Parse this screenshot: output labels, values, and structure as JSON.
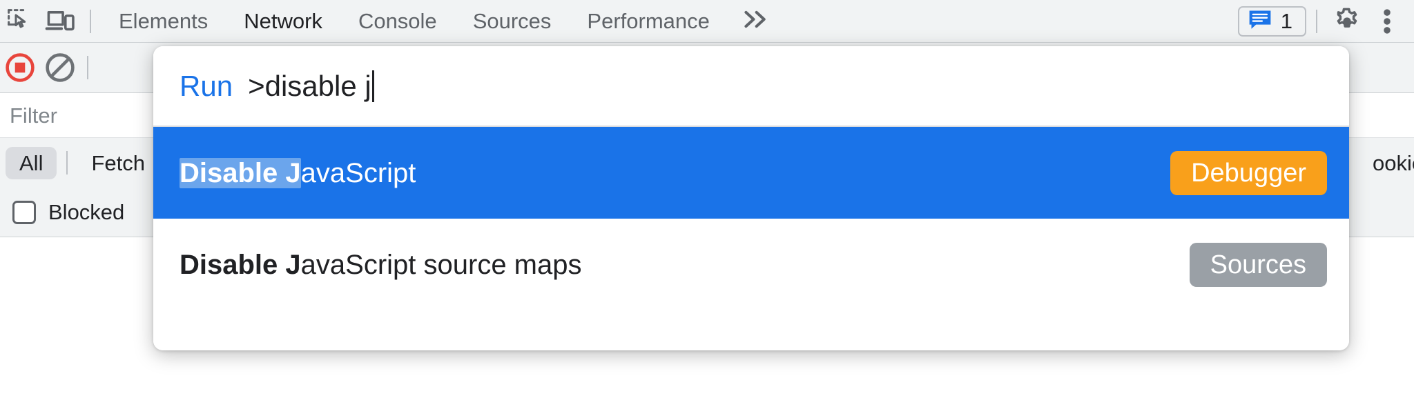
{
  "toolbar": {
    "inspect_icon": "inspect-element-icon",
    "device_icon": "device-toolbar-icon",
    "tabs": [
      {
        "label": "Elements",
        "selected": false
      },
      {
        "label": "Network",
        "selected": true
      },
      {
        "label": "Console",
        "selected": false
      },
      {
        "label": "Sources",
        "selected": false
      },
      {
        "label": "Performance",
        "selected": false
      }
    ],
    "more_tabs_label": "»",
    "message_count": "1",
    "message_icon": "console-message-icon",
    "settings_icon": "gear-icon",
    "more_options_icon": "three-dot-menu-icon",
    "accent_blue": "#1a73e8"
  },
  "network_toolbar": {
    "record_icon": "record-stop-icon",
    "record_color": "#e8453c",
    "clear_icon": "clear-network-log-icon"
  },
  "filter": {
    "placeholder": "Filter",
    "value": ""
  },
  "resource_types": [
    {
      "label": "All",
      "active": true
    },
    {
      "label": "Fetch",
      "active": false
    },
    {
      "label": "ookie",
      "active": false
    }
  ],
  "checkbox_bar": {
    "blocked_label": "Blocked",
    "blocked_checked": false
  },
  "command_palette": {
    "run_prefix": "Run",
    "query": ">disable j",
    "results": [
      {
        "match": "Disable J",
        "rest": "avaScript",
        "badge": "Debugger",
        "badge_color": "#f9a01b",
        "selected": true
      },
      {
        "match": "Disable J",
        "rest": "avaScript source maps",
        "badge": "Sources",
        "badge_color": "#9aa0a6",
        "selected": false
      }
    ]
  }
}
